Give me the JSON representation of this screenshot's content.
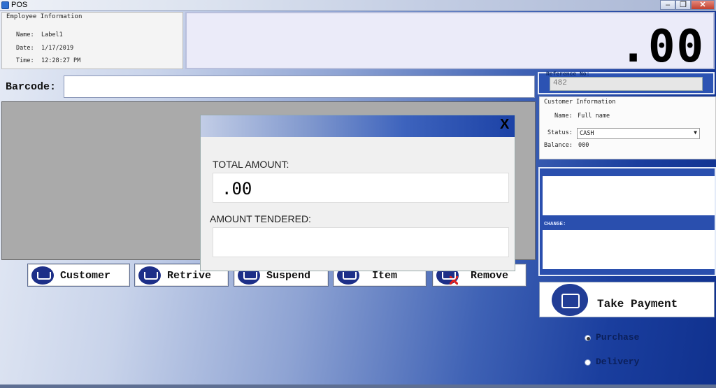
{
  "window": {
    "title": "POS",
    "min": "–",
    "max": "❐",
    "close": "✕"
  },
  "employee": {
    "heading": "Employee Information",
    "name_label": "Name:",
    "name_value": "Label1",
    "date_label": "Date:",
    "date_value": "1/17/2019",
    "time_label": "Time:",
    "time_value": "12:28:27 PM"
  },
  "total_display": ".00",
  "barcode": {
    "label": "Barcode:",
    "value": ""
  },
  "actions": [
    {
      "label": "Customer",
      "icon": "customer-cart-icon"
    },
    {
      "label": "Retrive",
      "icon": "keyboard-icon"
    },
    {
      "label": "Suspend",
      "icon": "suspend-cart-icon"
    },
    {
      "label": "Item",
      "icon": "cart-icon"
    },
    {
      "label": "Remove",
      "icon": "remove-cart-icon"
    }
  ],
  "reference": {
    "caption": "Reference No:",
    "value": "482"
  },
  "customer": {
    "heading": "Customer Information",
    "name_label": "Name:",
    "name_value": "Full name",
    "status_label": "Status:",
    "status_value": "CASH",
    "balance_label": "Balance:",
    "balance_value": "000"
  },
  "change": {
    "caption": "CHANGE:"
  },
  "take_payment": {
    "label": "Take Payment"
  },
  "order_type": {
    "options": [
      "Purchase",
      "Delivery"
    ],
    "selected": "Purchase"
  },
  "dialog": {
    "close": "X",
    "total_label": "TOTAL AMOUNT:",
    "total_value": ".00",
    "tendered_label": "AMOUNT TENDERED:",
    "tendered_value": ""
  }
}
